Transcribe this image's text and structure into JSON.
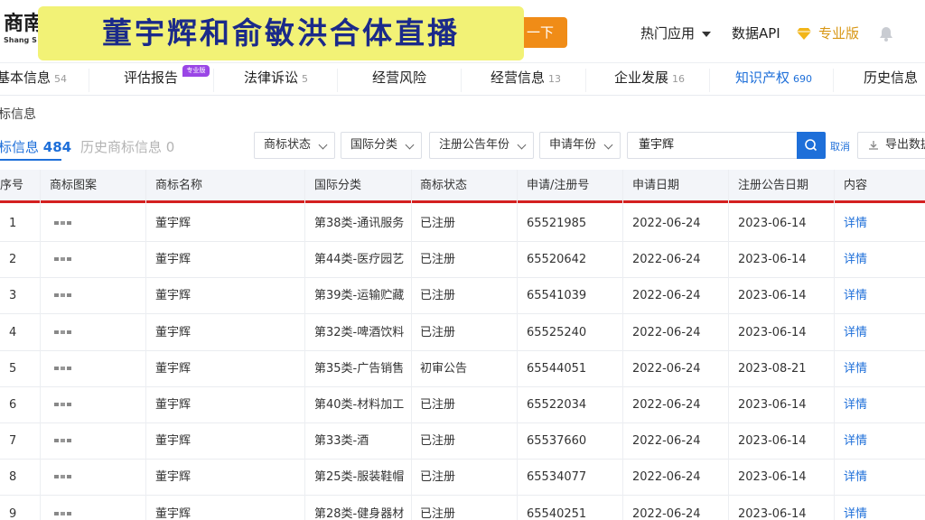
{
  "header": {
    "logo_main": "商南",
    "logo_sub": "Shang S",
    "search_button": "一下",
    "overlay_title": "董宇辉和俞敏洪合体直播",
    "menu": [
      {
        "label": "热门应用"
      },
      {
        "label": "数据API"
      },
      {
        "label": "专业版"
      }
    ]
  },
  "nav_tabs": [
    {
      "label": "基本信息",
      "count": "54"
    },
    {
      "label": "评估报告",
      "count": ""
    },
    {
      "label": "法律诉讼",
      "count": "5"
    },
    {
      "label": "经营风险",
      "count": ""
    },
    {
      "label": "经营信息",
      "count": "13"
    },
    {
      "label": "企业发展",
      "count": "16"
    },
    {
      "label": "知识产权",
      "count": "690"
    },
    {
      "label": "历史信息",
      "count": ""
    }
  ],
  "pro_badge": "专业版",
  "section_title": "标信息",
  "sub_tabs": [
    {
      "label": "标信息",
      "count": "484"
    },
    {
      "label": "历史商标信息",
      "count": "0"
    }
  ],
  "filters": {
    "status": "商标状态",
    "intl_class": "国际分类",
    "reg_year": "注册公告年份",
    "apply_year": "申请年份",
    "search_value": "董宇辉",
    "cancel": "取消",
    "export": "导出数据"
  },
  "table": {
    "headers": [
      "序号",
      "商标图案",
      "商标名称",
      "国际分类",
      "商标状态",
      "申请/注册号",
      "申请日期",
      "注册公告日期",
      "内容"
    ],
    "rows": [
      {
        "no": "1",
        "name": "董宇辉",
        "cls": "第38类-通讯服务",
        "status": "已注册",
        "reg": "65521985",
        "apply": "2022-06-24",
        "pub": "2023-06-14",
        "detail": "详情"
      },
      {
        "no": "2",
        "name": "董宇辉",
        "cls": "第44类-医疗园艺",
        "status": "已注册",
        "reg": "65520642",
        "apply": "2022-06-24",
        "pub": "2023-06-14",
        "detail": "详情"
      },
      {
        "no": "3",
        "name": "董宇辉",
        "cls": "第39类-运输贮藏",
        "status": "已注册",
        "reg": "65541039",
        "apply": "2022-06-24",
        "pub": "2023-06-14",
        "detail": "详情"
      },
      {
        "no": "4",
        "name": "董宇辉",
        "cls": "第32类-啤酒饮料",
        "status": "已注册",
        "reg": "65525240",
        "apply": "2022-06-24",
        "pub": "2023-06-14",
        "detail": "详情"
      },
      {
        "no": "5",
        "name": "董宇辉",
        "cls": "第35类-广告销售",
        "status": "初审公告",
        "reg": "65544051",
        "apply": "2022-06-24",
        "pub": "2023-08-21",
        "detail": "详情"
      },
      {
        "no": "6",
        "name": "董宇辉",
        "cls": "第40类-材料加工",
        "status": "已注册",
        "reg": "65522034",
        "apply": "2022-06-24",
        "pub": "2023-06-14",
        "detail": "详情"
      },
      {
        "no": "7",
        "name": "董宇辉",
        "cls": "第33类-酒",
        "status": "已注册",
        "reg": "65537660",
        "apply": "2022-06-24",
        "pub": "2023-06-14",
        "detail": "详情"
      },
      {
        "no": "8",
        "name": "董宇辉",
        "cls": "第25类-服装鞋帽",
        "status": "已注册",
        "reg": "65534077",
        "apply": "2022-06-24",
        "pub": "2023-06-14",
        "detail": "详情"
      },
      {
        "no": "9",
        "name": "董宇辉",
        "cls": "第28类-健身器材",
        "status": "已注册",
        "reg": "65540251",
        "apply": "2022-06-24",
        "pub": "2023-06-14",
        "detail": "详情"
      }
    ]
  }
}
